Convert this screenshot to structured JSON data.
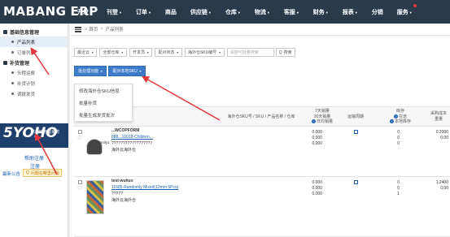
{
  "app": {
    "logo_left": "MABANG",
    "logo_right": "ERP"
  },
  "nav": [
    {
      "label": "开发",
      "dropdown": true
    },
    {
      "label": "刊登",
      "dropdown": true
    },
    {
      "label": "订单",
      "dropdown": true
    },
    {
      "label": "商品",
      "dropdown": false
    },
    {
      "label": "供应链",
      "dropdown": true
    },
    {
      "label": "仓库",
      "dropdown": true
    },
    {
      "label": "物流",
      "dropdown": true
    },
    {
      "label": "客服",
      "dropdown": true
    },
    {
      "label": "财务",
      "dropdown": true
    },
    {
      "label": "报表",
      "dropdown": true
    },
    {
      "label": "分销",
      "dropdown": false
    },
    {
      "label": "服务",
      "dropdown": true,
      "badge": true
    }
  ],
  "sidebar": {
    "groups": [
      {
        "label": "基础信息管理",
        "items": [
          {
            "label": "产品列表",
            "active": true
          },
          {
            "label": "订单列表",
            "active": false
          }
        ]
      },
      {
        "label": "补货管理",
        "items": [
          {
            "label": "头程运费",
            "active": false
          },
          {
            "label": "补货计划",
            "active": false
          },
          {
            "label": "调拨发货",
            "active": false
          }
        ]
      }
    ],
    "promo": {
      "big": "5YOHO",
      "tag": "供应链管理系统",
      "sub": "YOHO"
    },
    "help": "帮助注册",
    "register": "注册",
    "notice": "最新公告",
    "question_button": "问题在哪里问题"
  },
  "breadcrumb": {
    "home": "首页",
    "current": "产品列表"
  },
  "filters": {
    "selects": [
      "最近云",
      "全部仓库",
      "开发员",
      "配对状态",
      "海外仓SKU编号"
    ],
    "search_placeholder": "请按可批量搜索",
    "search_button": "搜索"
  },
  "actions": {
    "batch": "批处理功能",
    "pair": "配对本地SKU"
  },
  "batch_menu": [
    "修改海外仓SKU信息",
    "批量补货",
    "批量生成发货批次"
  ],
  "table": {
    "headers": {
      "product": "海外仓SKU号 / SKU / 产品名称 / 仓库",
      "sales_top": "7天销量",
      "sales_mid": "30天销量",
      "sales_bottom": "日均销量",
      "transit": "运输周期",
      "stock_top": "库存",
      "stock_mid": "在途",
      "stock_bottom": "本地库存",
      "cost_top": "采购成本",
      "cost_bottom": "重量"
    },
    "rows": [
      {
        "name": "...WCOPFORM",
        "sku": "888...10018-Children...",
        "extra": "??????????????????",
        "warehouse": "海外云海外仓",
        "user": "Emily1",
        "sales": [
          "0.000",
          "0.000",
          "0.000"
        ],
        "stock": [
          "0",
          "0",
          "0"
        ],
        "cost": [
          "0.2000",
          "0.00"
        ]
      },
      {
        "name": "test-wuhuo",
        "sku": "11685-Randomly Mixed(12mm 5Pcs)",
        "extra": "?????",
        "warehouse": "海外云海外仓",
        "user": "",
        "sales": [
          "0.000",
          "0.000",
          "0.000"
        ],
        "stock": [
          "0",
          "0",
          "1"
        ],
        "cost": [
          "1.2400",
          "0.00"
        ]
      }
    ]
  },
  "colors": {
    "topbar": "#2b3a4b",
    "accent": "#3d7cc9",
    "annotation": "#e4393c"
  }
}
